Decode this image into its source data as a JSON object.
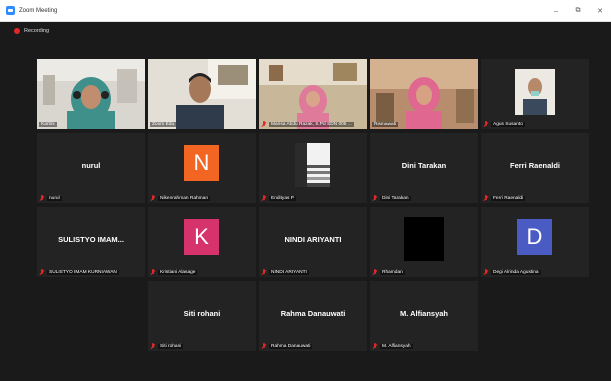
{
  "window": {
    "title": "Zoom Meeting",
    "minimize": "–",
    "restore": "⧉",
    "close": "✕"
  },
  "recording": {
    "label": "Recording",
    "color": "#e02828"
  },
  "colors": {
    "active_border": "#c9e265",
    "tile_bg": "#232323",
    "muted_icon": "#e02828"
  },
  "tiles": [
    {
      "name": "Kartini",
      "kind": "video",
      "active": true
    },
    {
      "name": "Zoom Edu",
      "kind": "video"
    },
    {
      "name": "Marisa Abdu Razak, S.Pd SDN 005 ...",
      "kind": "video"
    },
    {
      "name": "Rismawati",
      "kind": "video"
    },
    {
      "name": "Agus Susanto",
      "kind": "video"
    },
    {
      "name": "nurul",
      "kind": "name",
      "display": "nurul"
    },
    {
      "name": "Nikenrahman Rahman",
      "kind": "avatar",
      "initial": "N",
      "color": "#f26522"
    },
    {
      "name": "Endityas P",
      "kind": "image"
    },
    {
      "name": "Dini Tarakan",
      "kind": "name",
      "display": "Dini Tarakan"
    },
    {
      "name": "Ferri Raenaldi",
      "kind": "name",
      "display": "Ferri Raenaldi"
    },
    {
      "name": "SULISTYO IMAM KURNIAWAN",
      "kind": "name",
      "display": "SULISTYO IMAM..."
    },
    {
      "name": "Kristiani Alasage",
      "kind": "avatar",
      "initial": "K",
      "color": "#d6336c"
    },
    {
      "name": "NINDI ARIYANTI",
      "kind": "name",
      "display": "NINDI ARIYANTI"
    },
    {
      "name": "Rhamdan",
      "kind": "black"
    },
    {
      "name": "Degi Alrinda Agustina",
      "kind": "avatar",
      "initial": "D",
      "color": "#4a5bc4"
    },
    {
      "name": "Siti rohani",
      "kind": "name",
      "display": "Siti rohani"
    },
    {
      "name": "Rahma Danauwati",
      "kind": "name",
      "display": "Rahma Danauwati"
    },
    {
      "name": "M. Alfiansyah",
      "kind": "name",
      "display": "M. Alfiansyah"
    }
  ]
}
